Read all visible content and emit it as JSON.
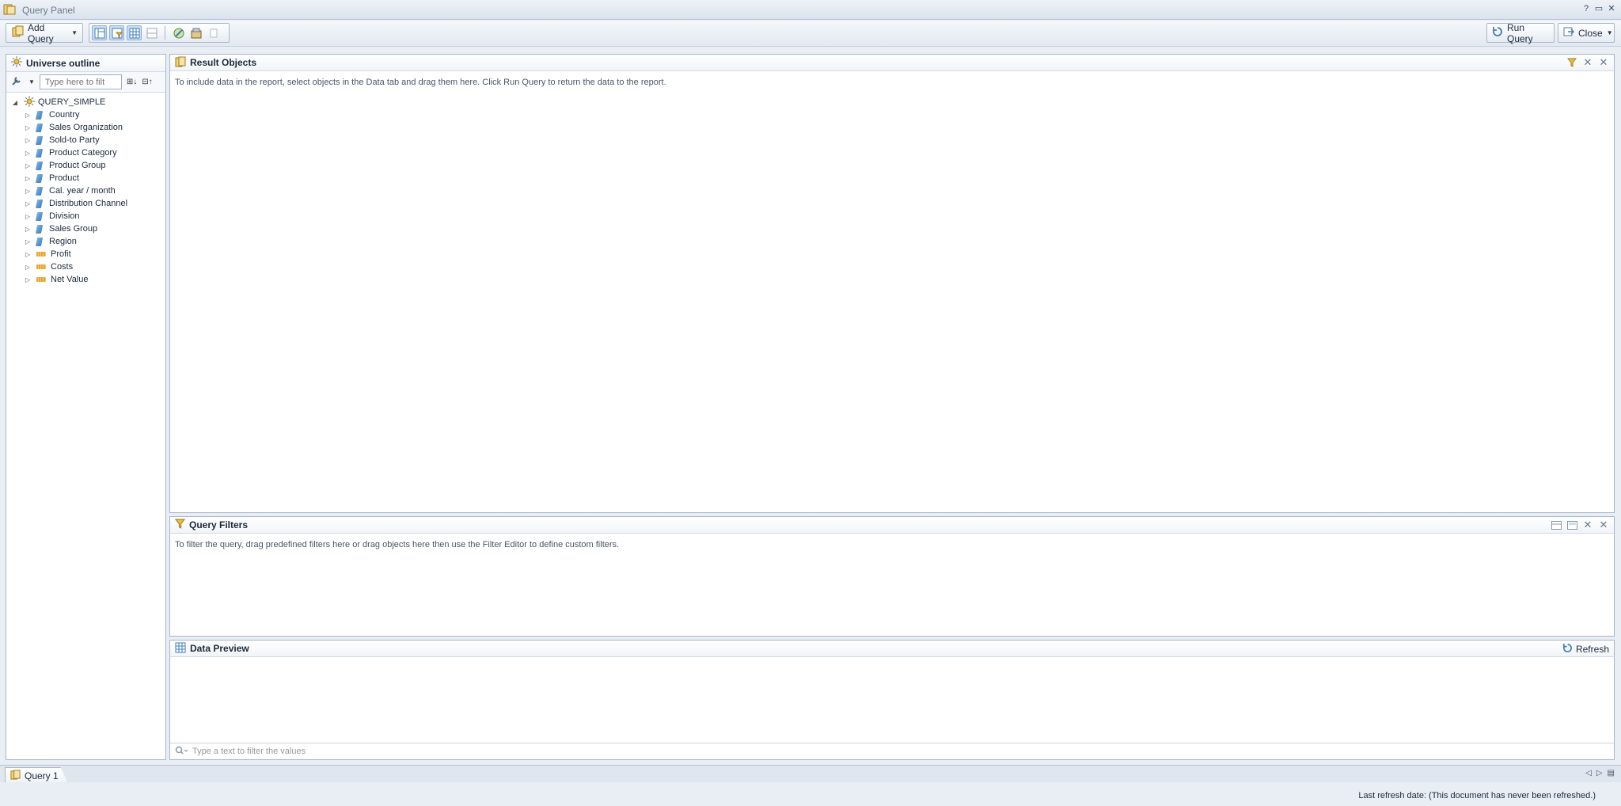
{
  "window": {
    "title": "Query Panel"
  },
  "toolbar": {
    "add_query_label": "Add Query",
    "run_query_label": "Run Query",
    "close_label": "Close"
  },
  "universe": {
    "title": "Universe outline",
    "filter_placeholder": "Type here to filt",
    "root": "QUERY_SIMPLE",
    "dimensions": [
      "Country",
      "Sales Organization",
      "Sold-to Party",
      "Product Category",
      "Product Group",
      "Product",
      "Cal. year / month",
      "Distribution Channel",
      "Division",
      "Sales Group",
      "Region"
    ],
    "measures": [
      "Profit",
      "Costs",
      "Net Value"
    ]
  },
  "result_objects": {
    "title": "Result Objects",
    "message": "To include data in the report, select objects in the Data tab and drag them here. Click Run Query to return the data to the report."
  },
  "query_filters": {
    "title": "Query Filters",
    "message": "To filter the query, drag predefined filters here or drag objects here then use the Filter Editor to define custom filters."
  },
  "data_preview": {
    "title": "Data Preview",
    "refresh_label": "Refresh",
    "filter_placeholder": "Type a text to filter the values"
  },
  "tabs": [
    {
      "label": "Query 1"
    }
  ],
  "status": {
    "text": "Last refresh date: (This document has never been refreshed.)"
  }
}
